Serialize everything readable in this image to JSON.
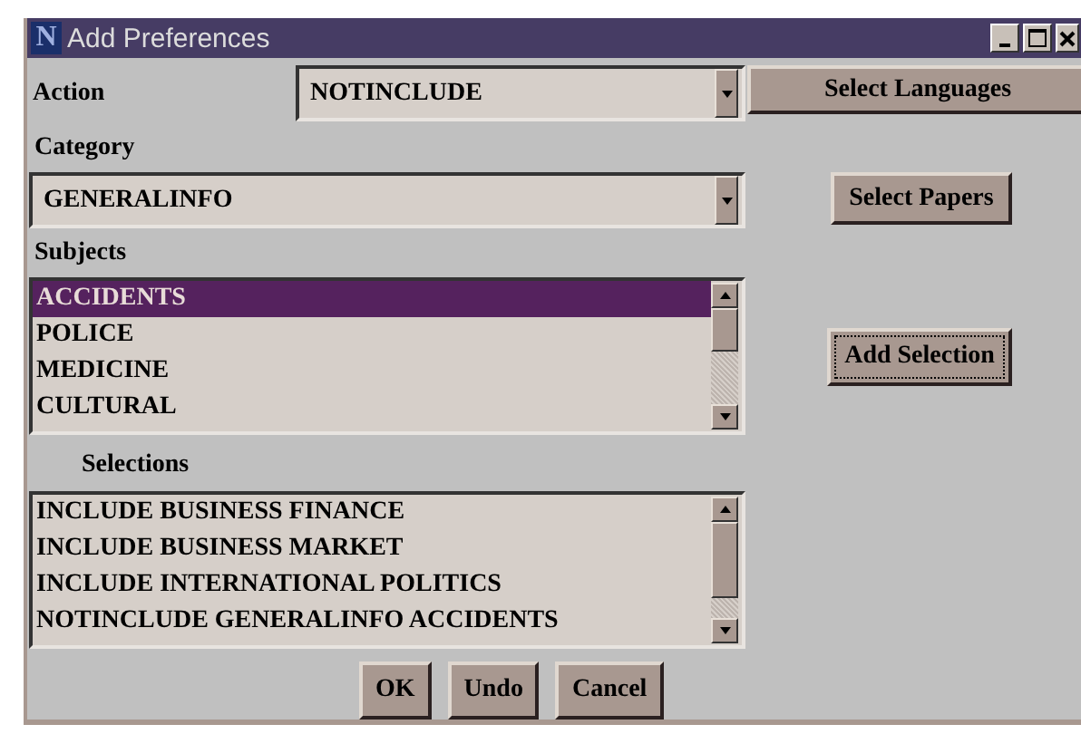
{
  "window": {
    "icon_letter": "N",
    "title": "Add Preferences"
  },
  "action": {
    "label": "Action",
    "value": "NOTINCLUDE"
  },
  "select_languages_button": "Select Languages",
  "category": {
    "label": "Category",
    "value": "GENERALINFO"
  },
  "select_papers_button": "Select Papers",
  "subjects": {
    "label": "Subjects",
    "items": [
      {
        "text": "ACCIDENTS",
        "selected": true
      },
      {
        "text": "POLICE",
        "selected": false
      },
      {
        "text": "MEDICINE",
        "selected": false
      },
      {
        "text": "CULTURAL",
        "selected": false
      }
    ]
  },
  "add_selection_button": {
    "label": "Add Selection",
    "focused": true
  },
  "selections": {
    "label": "Selections",
    "items": [
      {
        "text": "INCLUDE BUSINESS FINANCE",
        "selected": false
      },
      {
        "text": "INCLUDE BUSINESS MARKET",
        "selected": false
      },
      {
        "text": "INCLUDE INTERNATIONAL POLITICS",
        "selected": false
      },
      {
        "text": "NOTINCLUDE GENERALINFO ACCIDENTS",
        "selected": false
      }
    ]
  },
  "buttons": [
    "OK",
    "Undo",
    "Cancel"
  ]
}
